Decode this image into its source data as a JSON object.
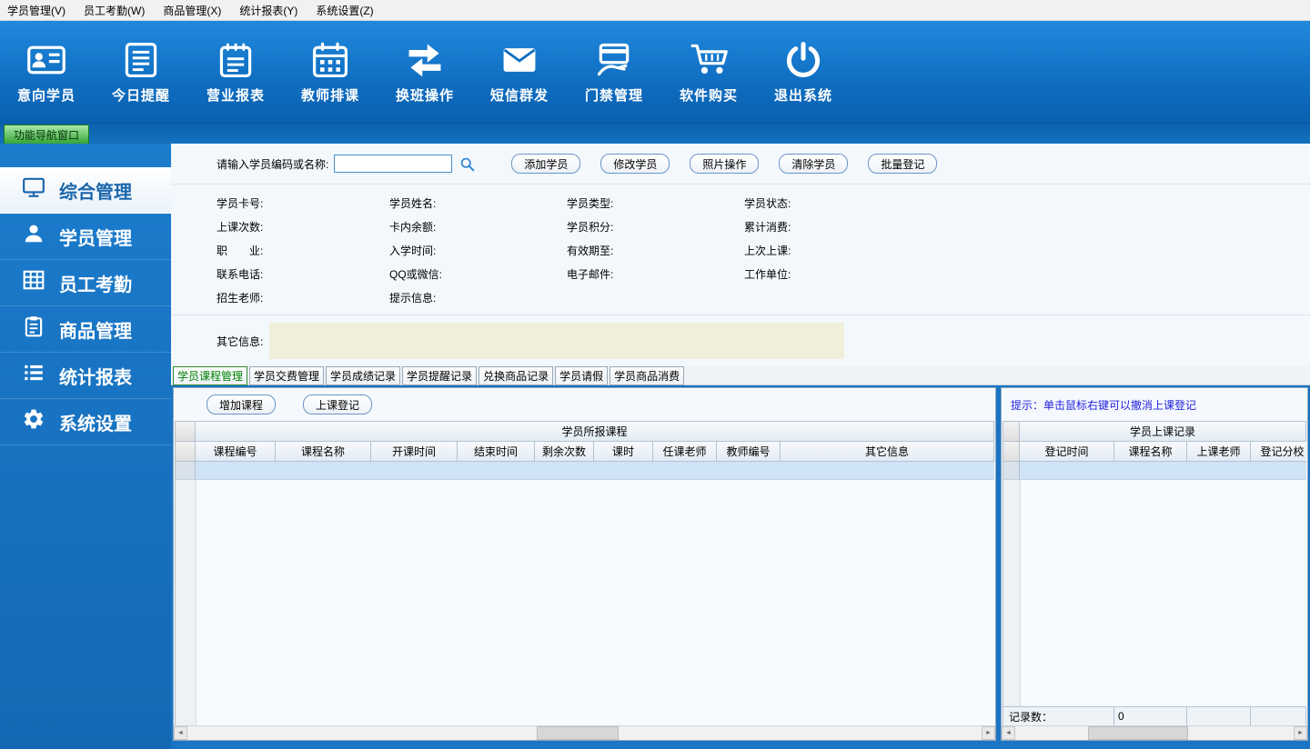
{
  "colors": {
    "accent_blue": "#1b74c4",
    "nav_tab_green": "#35a435",
    "hint_blue": "#2222dd",
    "other_info_bg": "#efefda",
    "selected_row": "#cfe5f7"
  },
  "menu_bar": {
    "items": [
      {
        "label": "学员管理(V)"
      },
      {
        "label": "员工考勤(W)"
      },
      {
        "label": "商品管理(X)"
      },
      {
        "label": "统计报表(Y)"
      },
      {
        "label": "系统设置(Z)"
      }
    ]
  },
  "toolbar": {
    "items": [
      {
        "label": "意向学员",
        "icon": "id-card-icon"
      },
      {
        "label": "今日提醒",
        "icon": "reminder-doc-icon"
      },
      {
        "label": "营业报表",
        "icon": "report-notepad-icon"
      },
      {
        "label": "教师排课",
        "icon": "calendar-icon"
      },
      {
        "label": "换班操作",
        "icon": "swap-arrows-icon"
      },
      {
        "label": "短信群发",
        "icon": "envelope-icon"
      },
      {
        "label": "门禁管理",
        "icon": "access-card-icon"
      },
      {
        "label": "软件购买",
        "icon": "shopping-cart-icon"
      },
      {
        "label": "退出系统",
        "icon": "power-icon"
      }
    ]
  },
  "nav_tab": {
    "label": "功能导航窗口"
  },
  "sidebar": {
    "items": [
      {
        "label": "综合管理",
        "icon": "monitor-icon",
        "active": true
      },
      {
        "label": "学员管理",
        "icon": "user-icon",
        "active": false
      },
      {
        "label": "员工考勤",
        "icon": "attendance-grid-icon",
        "active": false
      },
      {
        "label": "商品管理",
        "icon": "clipboard-icon",
        "active": false
      },
      {
        "label": "统计报表",
        "icon": "list-icon",
        "active": false
      },
      {
        "label": "系统设置",
        "icon": "gear-icon",
        "active": false
      }
    ]
  },
  "search": {
    "label": "请输入学员编码或名称:",
    "value": ""
  },
  "actions": {
    "add": "添加学员",
    "modify": "修改学员",
    "photo": "照片操作",
    "clear": "清除学员",
    "batch": "批量登记"
  },
  "info": {
    "rows": [
      {
        "c1": "学员卡号:",
        "c2": "学员姓名:",
        "c3": "学员类型:",
        "c4": "学员状态:"
      },
      {
        "c1": "上课次数:",
        "c2": "卡内余额:",
        "c3": "学员积分:",
        "c4": "累计消费:"
      },
      {
        "c1": "职　　业:",
        "c2": "入学时间:",
        "c3": "有效期至:",
        "c4": "上次上课:"
      },
      {
        "c1": "联系电话:",
        "c2": "QQ或微信:",
        "c3": "电子邮件:",
        "c4": "工作单位:"
      },
      {
        "c1": "招生老师:",
        "c2": "提示信息:",
        "c3": "",
        "c4": ""
      }
    ],
    "other_label": "其它信息:"
  },
  "tabs": {
    "items": [
      {
        "label": "学员课程管理",
        "active": true
      },
      {
        "label": "学员交费管理",
        "active": false
      },
      {
        "label": "学员成绩记录",
        "active": false
      },
      {
        "label": "学员提醒记录",
        "active": false
      },
      {
        "label": "兑换商品记录",
        "active": false
      },
      {
        "label": "学员请假",
        "active": false
      },
      {
        "label": "学员商品消费",
        "active": false
      }
    ]
  },
  "left_panel": {
    "buttons": {
      "add_course": "增加课程",
      "register": "上课登记"
    },
    "table": {
      "group_header": "学员所报课程",
      "columns": [
        "课程编号",
        "课程名称",
        "开课时间",
        "结束时间",
        "剩余次数",
        "课时",
        "任课老师",
        "教师编号",
        "其它信息"
      ],
      "rows": []
    }
  },
  "right_panel": {
    "hint": "提示：单击鼠标右键可以撤消上课登记",
    "table": {
      "group_header": "学员上课记录",
      "columns": [
        "登记时间",
        "课程名称",
        "上课老师",
        "登记分校"
      ],
      "rows": []
    },
    "footer": {
      "label": "记录数：",
      "count": "0"
    }
  },
  "scrollbar": {
    "left_arrow": "◄",
    "right_arrow": "►"
  }
}
